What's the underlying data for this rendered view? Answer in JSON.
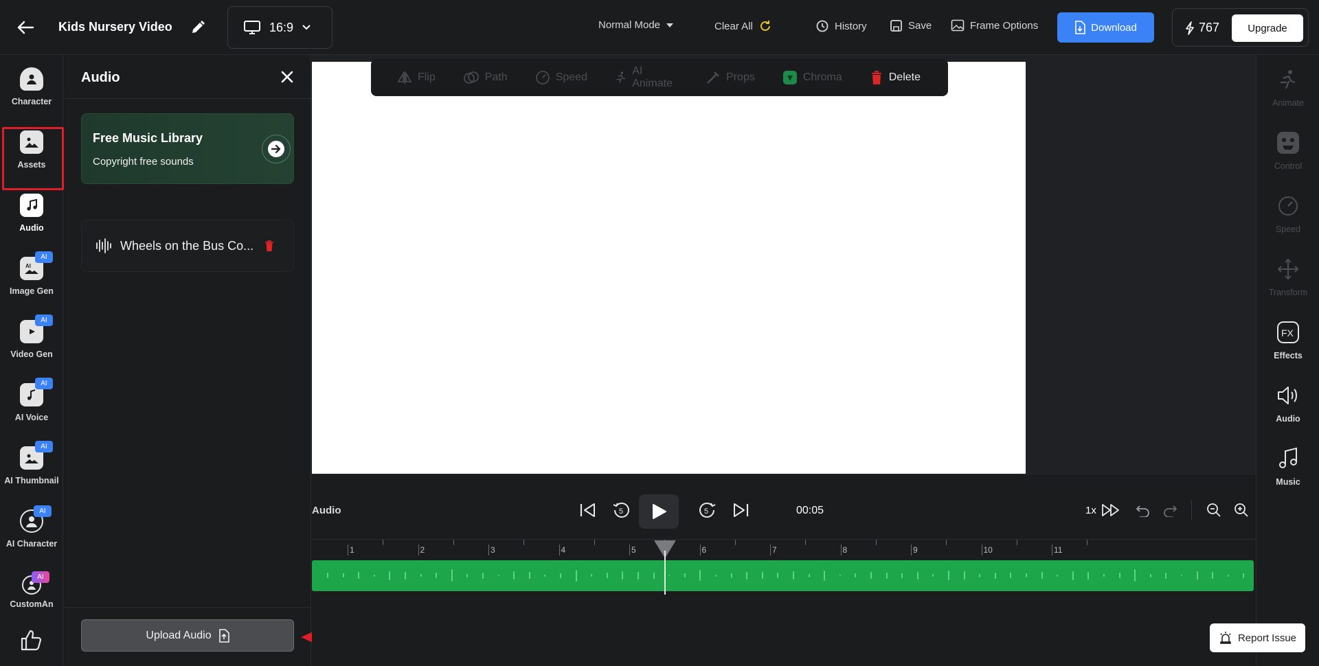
{
  "header": {
    "project_title": "Kids Nursery Video",
    "aspect_ratio": "16:9",
    "mode": "Normal Mode",
    "clear_all": "Clear All",
    "history": "History",
    "save": "Save",
    "frame_options": "Frame Options",
    "download": "Download",
    "credits": "767",
    "upgrade": "Upgrade"
  },
  "left_rail": {
    "items": [
      {
        "label": "Character",
        "icon": "character-icon"
      },
      {
        "label": "Assets",
        "icon": "assets-icon"
      },
      {
        "label": "Audio",
        "icon": "audio-note-icon",
        "selected": true
      },
      {
        "label": "Image Gen",
        "icon": "image-gen-icon",
        "badge": "AI"
      },
      {
        "label": "Video Gen",
        "icon": "video-gen-icon",
        "badge": "AI"
      },
      {
        "label": "AI Voice",
        "icon": "ai-voice-icon",
        "badge": "AI"
      },
      {
        "label": "AI Thumbnail",
        "icon": "ai-thumbnail-icon",
        "badge": "AI"
      },
      {
        "label": "AI Character",
        "icon": "ai-character-icon",
        "badge": "AI"
      },
      {
        "label": "CustomAn",
        "icon": "custom-animation-icon",
        "badge": "AI"
      }
    ]
  },
  "audio_panel": {
    "title": "Audio",
    "library_card": {
      "title": "Free Music Library",
      "subtitle": "Copyright free sounds"
    },
    "tracks": [
      {
        "name": "Wheels on the Bus Co..."
      }
    ],
    "upload_button": "Upload Audio"
  },
  "canvas_toolbar": {
    "tools": [
      {
        "label": "Flip",
        "enabled": false
      },
      {
        "label": "Path",
        "enabled": false
      },
      {
        "label": "Speed",
        "enabled": false
      },
      {
        "label": "AI Animate",
        "enabled": false
      },
      {
        "label": "Props",
        "enabled": false
      },
      {
        "label": "Chroma",
        "enabled": false
      },
      {
        "label": "Delete",
        "enabled": true
      }
    ]
  },
  "right_rail": {
    "items": [
      {
        "label": "Animate",
        "enabled": false
      },
      {
        "label": "Control",
        "enabled": false
      },
      {
        "label": "Speed",
        "enabled": false
      },
      {
        "label": "Transform",
        "enabled": false
      },
      {
        "label": "Effects",
        "enabled": true
      },
      {
        "label": "Audio",
        "enabled": true
      },
      {
        "label": "Music",
        "enabled": true
      }
    ]
  },
  "timeline": {
    "track_label": "Audio",
    "current_time": "00:05",
    "speed": "1x",
    "ruler_labels": [
      "1",
      "2",
      "3",
      "4",
      "5",
      "6",
      "7",
      "8",
      "9",
      "10",
      "11"
    ],
    "playhead_seconds": 5.5
  },
  "report_issue": "Report Issue",
  "colors": {
    "accent_blue": "#3b82f6",
    "track_green": "#1ea64a",
    "highlight_red": "#e11d2a"
  }
}
